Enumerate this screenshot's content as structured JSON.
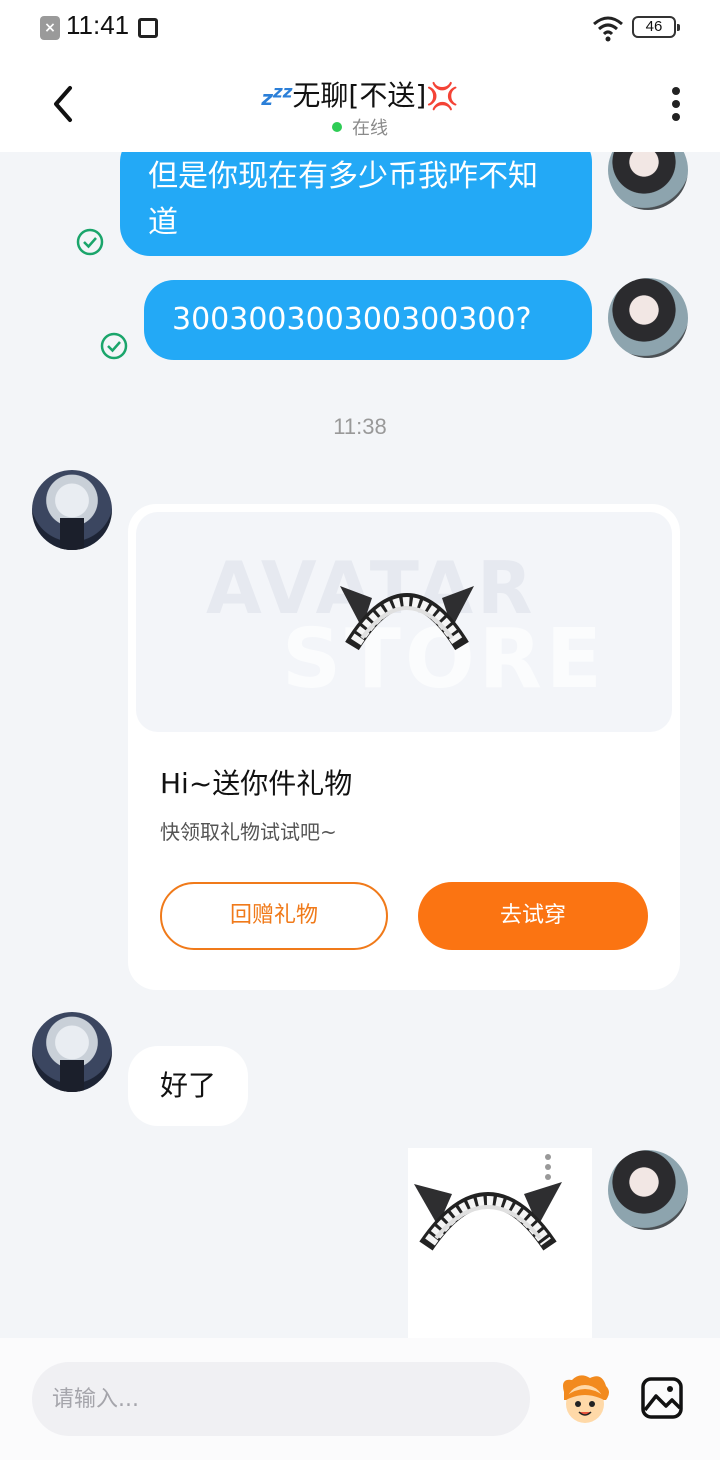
{
  "status_bar": {
    "time": "11:41",
    "notification_icon": "x-notification-icon",
    "screenshot_icon": "screenshot-icon",
    "wifi_icon": "wifi-icon",
    "battery": "46"
  },
  "header": {
    "title_prefix_icon": "zzz",
    "title": "无聊[不送]",
    "title_suffix_icon": "💢",
    "status": "在线",
    "status_color": "#2ecc55"
  },
  "messages": {
    "outgoing_1": "但是你现在有多少币我咋不知道",
    "outgoing_2": "300300300300300300?",
    "timestamp": "11:38",
    "gift_card": {
      "watermark_line1": "AVATAR",
      "watermark_line2": "STORE",
      "title": "Hi~送你件礼物",
      "subtitle": "快领取礼物试试吧~",
      "return_gift_button": "回赠礼物",
      "try_on_button": "去试穿"
    },
    "incoming_text": "好了"
  },
  "input_bar": {
    "placeholder": "请输入..."
  },
  "colors": {
    "outgoing_bubble": "#23a9f6",
    "accent_orange": "#fb7412",
    "read_check": "#1aa56b"
  }
}
